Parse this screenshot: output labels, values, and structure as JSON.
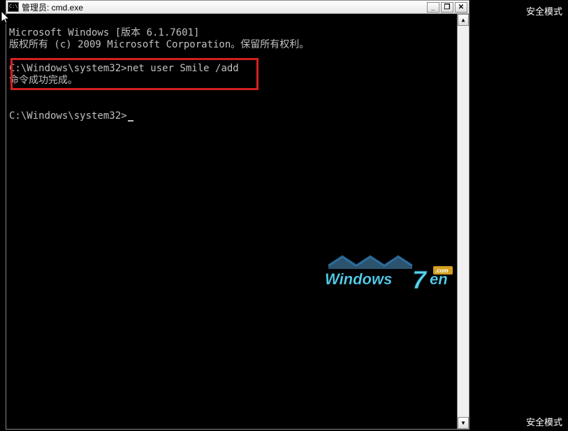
{
  "window": {
    "title": "管理员: cmd.exe"
  },
  "terminal": {
    "line1": "Microsoft Windows [版本 6.1.7601]",
    "line2": "版权所有 (c) 2009 Microsoft Corporation。保留所有权利。",
    "prompt1_path": "C:\\Windows\\system32>",
    "command1": "net user Smile /add",
    "result1": "命令成功完成。",
    "prompt2_path": "C:\\Windows\\system32>"
  },
  "labels": {
    "safe_mode": "安全模式",
    "safe_mode_bottom_left": "安全模式"
  },
  "watermark": {
    "text": "Windows7en",
    "suffix": ".com"
  },
  "titlebar_buttons": {
    "minimize": "_",
    "maximize": "❐",
    "close": "✕"
  },
  "scroll": {
    "up": "▲",
    "down": "▼"
  }
}
